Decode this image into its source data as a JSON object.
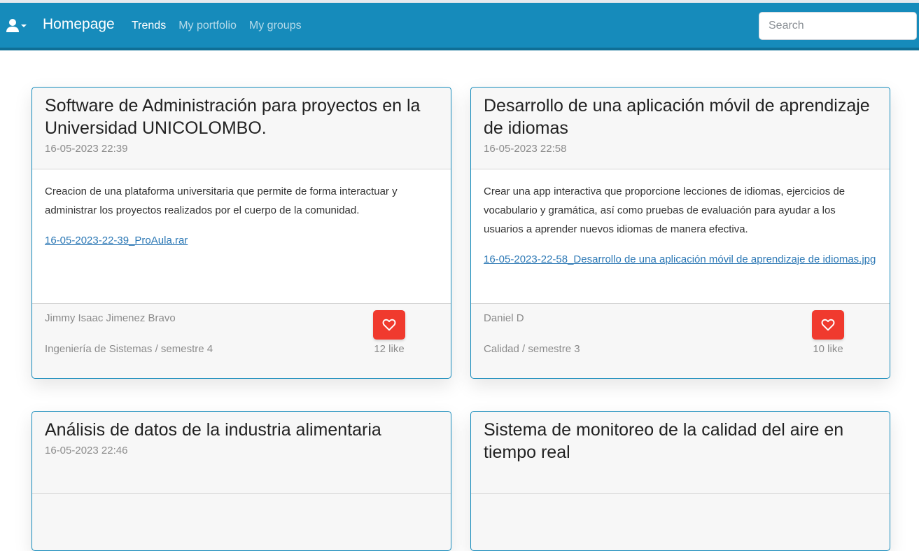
{
  "navbar": {
    "brand": "Homepage",
    "links": [
      {
        "label": "Trends",
        "active": true
      },
      {
        "label": "My portfolio",
        "active": false
      },
      {
        "label": "My groups",
        "active": false
      }
    ],
    "search_placeholder": "Search",
    "color": "#168bbb",
    "user_icon": "user-icon"
  },
  "cards": [
    {
      "title": "Software de Administración para proyectos en la Universidad UNICOLOMBO.",
      "date": "16-05-2023 22:39",
      "description": "Creacion de una plataforma universitaria que permite de forma interactuar y administrar los proyectos realizados por el cuerpo de la comunidad.",
      "file": "16-05-2023-22-39_ProAula.rar",
      "author": "Jimmy Isaac Jimenez Bravo",
      "program": "Ingeniería de Sistemas / semestre 4",
      "likes": "12 like"
    },
    {
      "title": "Desarrollo de una aplicación móvil de aprendizaje de idiomas",
      "date": "16-05-2023 22:58",
      "description": "Crear una app interactiva que proporcione lecciones de idiomas, ejercicios de vocabulario y gramática, así como pruebas de evaluación para ayudar a los usuarios a aprender nuevos idiomas de manera efectiva.",
      "file": "16-05-2023-22-58_Desarrollo de una aplicación móvil de aprendizaje de idiomas.jpg",
      "author": "Daniel D",
      "program": "Calidad / semestre 3",
      "likes": "10 like"
    },
    {
      "title": "Análisis de datos de la industria alimentaria",
      "date": "16-05-2023 22:46"
    },
    {
      "title": "Sistema de monitoreo de la calidad del aire en tiempo real"
    }
  ],
  "colors": {
    "like_button": "#f03a2e",
    "link": "#2c78b5"
  },
  "icons": {
    "like": "heart-icon"
  }
}
